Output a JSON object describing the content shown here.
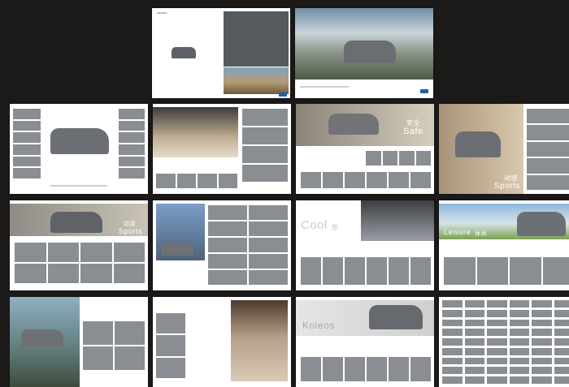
{
  "brand": {
    "accent": "#1f5ea8",
    "background": "#1c1919"
  },
  "pages": {
    "p1": {
      "caption": "KOLEOS"
    },
    "p3": {
      "big": "安全",
      "big_en": "Safe"
    },
    "p4": {
      "big": "动感",
      "big_en": "Sports"
    },
    "p5": {
      "big": "动感",
      "big_en": "Sports"
    },
    "p7": {
      "big": "Cool",
      "big_cn": "酷"
    },
    "p8": {
      "big": "Leisure",
      "big_cn": "休闲"
    },
    "p11": {
      "big": "Koleos"
    }
  }
}
